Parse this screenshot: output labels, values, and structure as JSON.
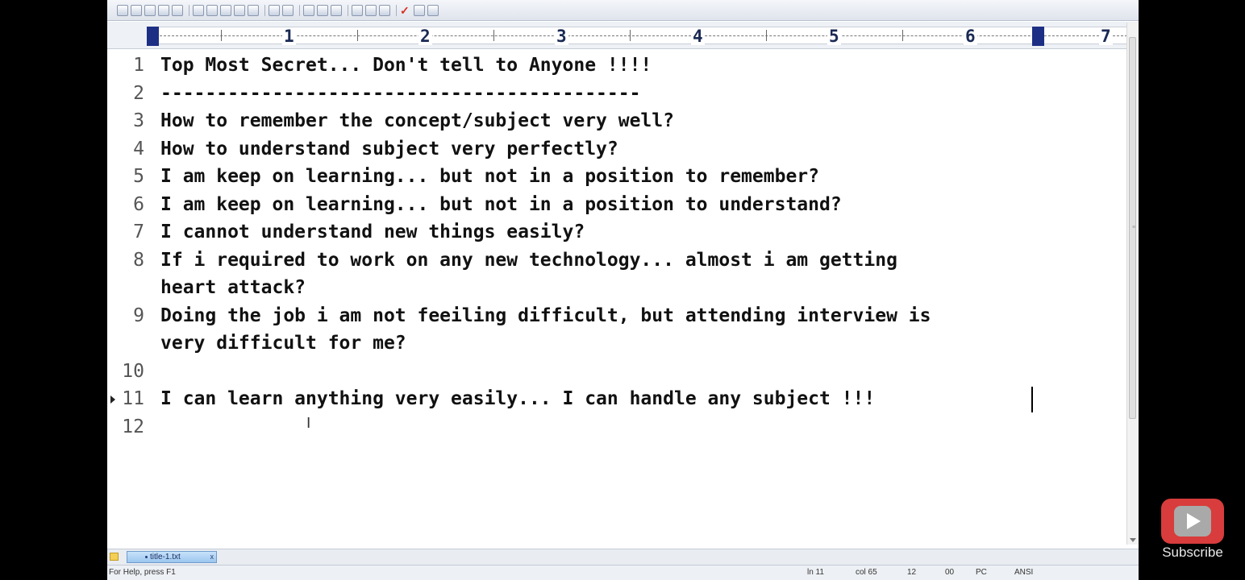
{
  "toolbar": {
    "icons": [
      "new-file-icon",
      "open-folder-icon",
      "save-icon",
      "print-preview-icon",
      "print-icon",
      "spell-check-icon",
      "cut-icon",
      "copy-icon",
      "paste-icon",
      "delete-icon",
      "undo-icon",
      "redo-icon",
      "find-icon",
      "replace-icon",
      "goto-icon",
      "font-icon",
      "word-wrap-icon",
      "column-mode-icon",
      "check-icon",
      "window-icon",
      "help-icon"
    ]
  },
  "ruler": {
    "numbers": [
      "1",
      "2",
      "3",
      "4",
      "5",
      "6",
      "7"
    ]
  },
  "editor": {
    "lines": [
      {
        "number": "1",
        "text": "Top Most Secret... Don't tell to Anyone !!!!"
      },
      {
        "number": "2",
        "text": "-------------------------------------------"
      },
      {
        "number": "3",
        "text": "How to remember the concept/subject very well?"
      },
      {
        "number": "4",
        "text": "How to understand subject very perfectly?"
      },
      {
        "number": "5",
        "text": "I am keep on learning... but not in a position to remember?"
      },
      {
        "number": "6",
        "text": "I am keep on learning... but not in a position to understand?"
      },
      {
        "number": "7",
        "text": "I cannot understand new things easily?"
      },
      {
        "number": "8",
        "text": "If i required to work on any new technology... almost i am getting"
      },
      {
        "number": "",
        "text": "heart attack?"
      },
      {
        "number": "9",
        "text": "Doing the job i am not feeiling difficult, but attending interview is"
      },
      {
        "number": "",
        "text": "very difficult for me?"
      },
      {
        "number": "10",
        "text": ""
      },
      {
        "number": "11",
        "text": "I can learn anything very easily... I can handle any subject !!!"
      },
      {
        "number": "12",
        "text": ""
      }
    ]
  },
  "tabs": {
    "active_file": "title-1.txt",
    "close_label": "x"
  },
  "status": {
    "help": "For Help, press F1",
    "line": "ln 11",
    "col": "col 65",
    "num": "12",
    "code": "00",
    "mode": "PC",
    "encoding": "ANSI"
  },
  "overlay": {
    "subscribe_label": "Subscribe"
  },
  "colors": {
    "ruler_marker": "#1d2f84",
    "tab_active": "#9cc6ee",
    "youtube_red": "#d83c3c"
  }
}
